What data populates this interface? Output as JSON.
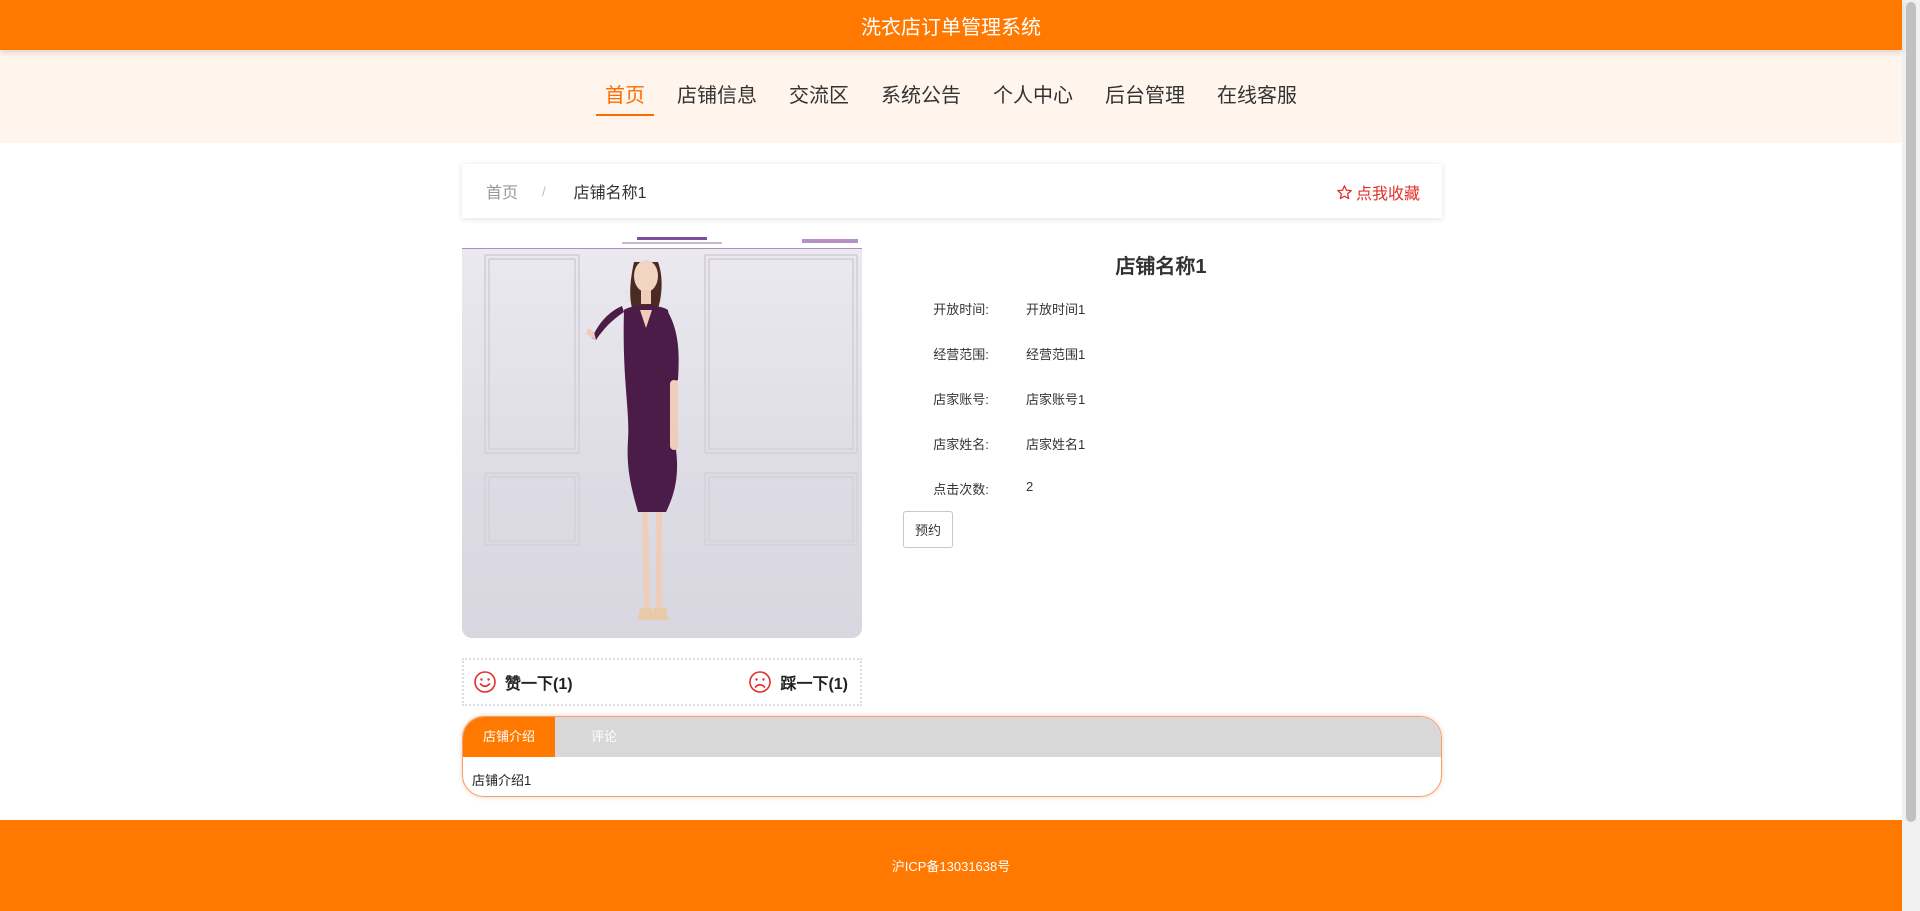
{
  "header": {
    "title": "洗衣店订单管理系统"
  },
  "nav": {
    "items": [
      {
        "label": "首页",
        "active": true
      },
      {
        "label": "店铺信息"
      },
      {
        "label": "交流区"
      },
      {
        "label": "系统公告"
      },
      {
        "label": "个人中心"
      },
      {
        "label": "后台管理"
      },
      {
        "label": "在线客服"
      }
    ]
  },
  "breadcrumb": {
    "home": "首页",
    "separator": "/",
    "current": "店铺名称1"
  },
  "favorite": {
    "label": "点我收藏",
    "icon": "star-outline-icon"
  },
  "shop": {
    "name": "店铺名称1",
    "fields": [
      {
        "label": "开放时间:",
        "value": "开放时间1"
      },
      {
        "label": "经营范围:",
        "value": "经营范围1"
      },
      {
        "label": "店家账号:",
        "value": "店家账号1"
      },
      {
        "label": "店家姓名:",
        "value": "店家姓名1"
      },
      {
        "label": "点击次数:",
        "value": "2"
      }
    ],
    "reserve_label": "预约"
  },
  "votes": {
    "up_label": "赞一下(1)",
    "down_label": "踩一下(1)"
  },
  "tabs": {
    "items": [
      {
        "label": "店铺介绍",
        "active": true
      },
      {
        "label": "评论"
      }
    ],
    "content": "店铺介绍1"
  },
  "footer": {
    "text": "沪ICP备13031638号"
  },
  "colors": {
    "brand": "#ff7800",
    "nav_bg": "#fff5ec",
    "favorite": "#e0302c"
  }
}
